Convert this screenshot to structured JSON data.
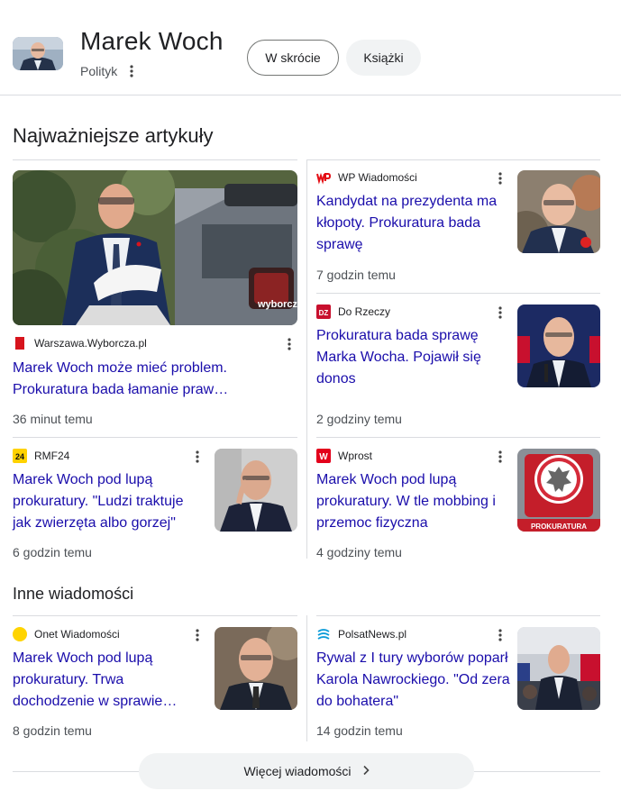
{
  "entity": {
    "name": "Marek Woch",
    "type": "Polityk"
  },
  "chips": [
    {
      "label": "W skrócie"
    },
    {
      "label": "Książki"
    }
  ],
  "top_stories": {
    "title": "Najważniejsze artykuły",
    "featured": {
      "source": "Warszawa.Wyborcza.pl",
      "headline": "Marek Woch może mieć problem. Prokuratura bada łamanie praw…",
      "time": "36 minut temu",
      "image_watermark": "wyborcza.pl"
    },
    "items": [
      {
        "source": "WP Wiadomości",
        "headline": "Kandydat na prezydenta ma kłopoty. Prokuratura bada sprawę",
        "time": "7 godzin temu"
      },
      {
        "source": "Do Rzeczy",
        "headline": "Prokuratura bada sprawę Marka Wocha. Pojawił się donos",
        "time": "2 godziny temu"
      },
      {
        "source": "RMF24",
        "headline": "Marek Woch pod lupą prokuratury. \"Ludzi traktuje jak zwierzęta albo gorzej\"",
        "time": "6 godzin temu"
      },
      {
        "source": "Wprost",
        "headline": "Marek Woch pod lupą prokuratury. W tle mobbing i przemoc fizyczna",
        "time": "4 godziny temu",
        "image_text": "PROKURATURA"
      }
    ]
  },
  "other_news": {
    "title": "Inne wiadomości",
    "items": [
      {
        "source": "Onet Wiadomości",
        "headline": "Marek Woch pod lupą prokuratury. Trwa dochodzenie w sprawie…",
        "time": "8 godzin temu"
      },
      {
        "source": "PolsatNews.pl",
        "headline": "Rywal z I tury wyborów poparł Karola Nawrockiego. \"Od zera do bohatera\"",
        "time": "14 godzin temu"
      }
    ]
  },
  "more_button": {
    "label": "Więcej wiadomości"
  },
  "logos": {
    "rmf_text": "24",
    "do_rzeczy_text": "DZ",
    "wprost_text": "W"
  },
  "colors": {
    "link": "#1a0dab",
    "divider": "#dadce0",
    "chip_bg": "#f1f3f4",
    "wp_red": "#e40d14",
    "wyborcza_red": "#d7141d",
    "rmf_yellow": "#ffd200",
    "onet_yellow": "#ffd400",
    "do_rzeczy_red": "#c8102e"
  }
}
